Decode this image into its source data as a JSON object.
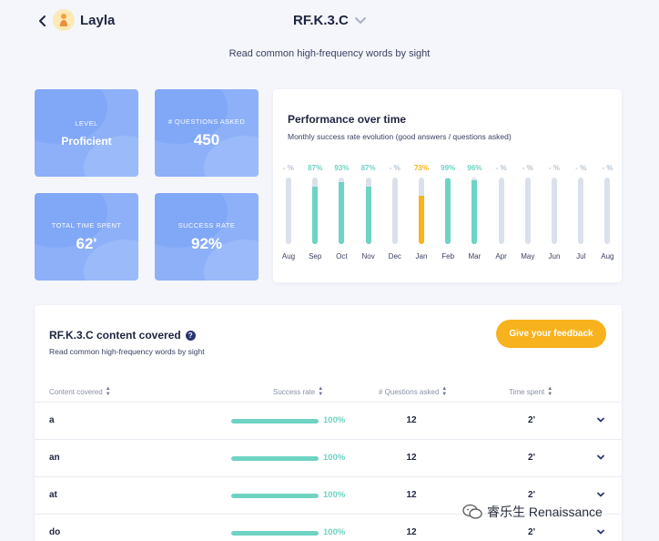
{
  "header": {
    "student_name": "Layla",
    "standard_code": "RF.K.3.C",
    "subtitle": "Read common high-frequency words by sight"
  },
  "stats": {
    "level": {
      "label": "LEVEL",
      "value": "Proficient"
    },
    "questions": {
      "label": "# QUESTIONS ASKED",
      "value": "450"
    },
    "time": {
      "label": "TOTAL TIME SPENT",
      "value": "62'"
    },
    "success": {
      "label": "SUCCESS RATE",
      "value": "92%"
    }
  },
  "performance": {
    "title": "Performance over time",
    "subtitle": "Monthly success rate evolution (good answers / questions asked)"
  },
  "chart_data": {
    "type": "bar",
    "categories": [
      "Aug",
      "Sep",
      "Oct",
      "Nov",
      "Dec",
      "Jan",
      "Feb",
      "Mar",
      "Apr",
      "May",
      "Jun",
      "Jul",
      "Aug"
    ],
    "values": [
      null,
      87,
      93,
      87,
      null,
      73,
      99,
      96,
      null,
      null,
      null,
      null,
      null
    ],
    "labels": [
      "- %",
      "87%",
      "93%",
      "87%",
      "- %",
      "73%",
      "99%",
      "96%",
      "- %",
      "- %",
      "- %",
      "- %",
      "- %"
    ],
    "ylim": [
      0,
      100
    ],
    "colors": {
      "good": "#6ed3c3",
      "medium": "#f8b21d",
      "empty": "#dbe1ea",
      "nodata_label": "#b8c4cf"
    }
  },
  "content": {
    "title": "RF.K.3.C content covered",
    "subtitle": "Read common high-frequency words by sight",
    "feedback_label": "Give your feedback",
    "columns": {
      "content": "Content covered",
      "success": "Success rate",
      "questions": "# Questions asked",
      "time": "Time spent"
    },
    "rows": [
      {
        "word": "a",
        "success": 100,
        "success_label": "100%",
        "questions": "12",
        "time": "2'"
      },
      {
        "word": "an",
        "success": 100,
        "success_label": "100%",
        "questions": "12",
        "time": "2'"
      },
      {
        "word": "at",
        "success": 100,
        "success_label": "100%",
        "questions": "12",
        "time": "2'"
      },
      {
        "word": "do",
        "success": 100,
        "success_label": "100%",
        "questions": "12",
        "time": "2'"
      }
    ]
  },
  "watermark": {
    "text": "睿乐生 Renaissance"
  },
  "colors": {
    "card_blue": "#8db0f8",
    "accent_teal": "#6ed3c3",
    "accent_yellow": "#f8b21d",
    "text_dark": "#1f2540"
  }
}
